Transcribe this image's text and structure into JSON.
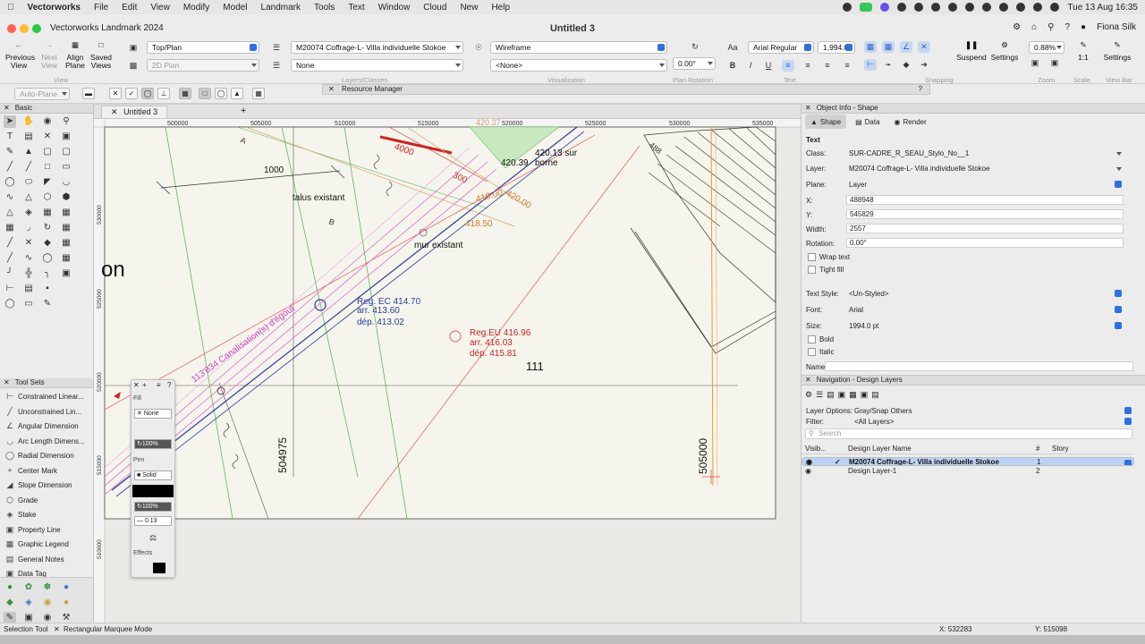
{
  "menubar": {
    "app": "Vectorworks",
    "items": [
      "File",
      "Edit",
      "View",
      "Modify",
      "Model",
      "Landmark",
      "Tools",
      "Text",
      "Window",
      "Cloud",
      "New",
      "Help"
    ],
    "clock": "Tue 13 Aug  16:35"
  },
  "window": {
    "title": "Vectorworks Landmark 2024",
    "doc_title": "Untitled 3",
    "user": "Fiona Silk"
  },
  "toolbar": {
    "previous_view": "Previous View",
    "next_view": "Next View",
    "align_plane": "Align Plane",
    "saved_views": "Saved Views",
    "view_group": "View",
    "view_select": "Top/Plan",
    "plane_select": "2D Plan",
    "layer_select": "M20074 Coffrage-L- Villa individuelle Stokoe",
    "class_select": "None",
    "layers_group": "Layers/Classes",
    "render_select": "Wireframe",
    "none_select": "<None>",
    "visualization_group": "Visualization",
    "rotation": "0.00°",
    "plan_rotation_group": "Plan Rotation",
    "font_select": "Arial Regular",
    "font_size": "1,994.0",
    "text_group": "Text",
    "snapping_group": "Snapping",
    "suspend": "Suspend",
    "settings": "Settings",
    "zoom_value": "0.88%",
    "zoom_group": "Zoom",
    "scale_value": "1:1",
    "scale_group": "Scale",
    "settings2": "Settings",
    "viewbar_group": "View Bar"
  },
  "modebar": {
    "auto_plane": "Auto-Plane"
  },
  "resource_manager": "Resource Manager",
  "basic": {
    "title": "Basic"
  },
  "toolsets": {
    "title": "Tool Sets",
    "items": [
      "Constrained Linear...",
      "Unconstrained Lin...",
      "Angular Dimension",
      "Arc Length Dimens...",
      "Radial Dimension",
      "Center Mark",
      "Slope Dimension",
      "Grade",
      "Stake",
      "Property Line",
      "Graphic Legend",
      "General Notes",
      "Data Tag"
    ]
  },
  "document": {
    "tab": "Untitled 3"
  },
  "ruler": {
    "top": [
      "500000",
      "505000",
      "510000",
      "515000",
      "520000",
      "525000",
      "530000",
      "535000"
    ],
    "left": [
      "530000",
      "525000",
      "520000",
      "515000",
      "510000"
    ]
  },
  "drawing": {
    "labels": {
      "dim1000": "1000",
      "talus": "talus existant",
      "mur": "mur existant",
      "d4000": "4000",
      "d300": "300",
      "sur_borne": "420.13 sur\nborne",
      "h42039": "420.39",
      "h41900": "419.00",
      "h42000": "420.00",
      "h41850": "418.50",
      "h42037": "420.37",
      "d488": "488",
      "reg_ec": "Reg. EC 414.70",
      "reg_ec_arr": "arr. 413.60",
      "reg_ec_dep": "dép. 413.02",
      "reg_eu": "Reg.EU 416.96",
      "reg_eu_arr": "arr. 416.03",
      "reg_eu_dep": "dép. 415.81",
      "n111": "111",
      "canal": "113'834 Canalisation(s) d'égout",
      "n504975": "504975",
      "n505000": "505000",
      "on": "on",
      "lblA": "A",
      "lblB": "B"
    }
  },
  "attributes": {
    "fill_label": "Fill",
    "fill_value": "None",
    "fill_opacity": "100%",
    "pen_label": "Pen",
    "pen_value": "Solid",
    "pen_opacity": "100%",
    "pen_weight": "0.13",
    "effects_label": "Effects"
  },
  "object_info": {
    "title": "Object Info - Shape",
    "tabs": [
      "Shape",
      "Data",
      "Render"
    ],
    "type": "Text",
    "class_label": "Class:",
    "class_value": "SUR-CADRE_R_SEAU_Stylo_No__1",
    "layer_label": "Layer:",
    "layer_value": "M20074 Coffrage-L- Villa individuelle Stokoe",
    "plane_label": "Plane:",
    "plane_value": "Layer",
    "x_label": "X:",
    "x_value": "488948",
    "y_label": "Y:",
    "y_value": "545829",
    "width_label": "Width:",
    "width_value": "2557",
    "rotation_label": "Rotation:",
    "rotation_value": "0.00°",
    "wrap_text": "Wrap text",
    "tight_fill": "Tight fill",
    "text_style_label": "Text Style:",
    "text_style_value": "<Un-Styled>",
    "font_label": "Font:",
    "font_value": "Arial",
    "size_label": "Size:",
    "size_value": "1994.0 pt",
    "bold": "Bold",
    "italic": "Italic",
    "name_label": "Name:"
  },
  "navigation": {
    "title": "Navigation - Design Layers",
    "layer_options_label": "Layer Options:",
    "layer_options_value": "Gray/Snap Others",
    "filter_label": "Filter:",
    "filter_value": "<All Layers>",
    "search_placeholder": "Search",
    "col_visibility": "Visib...",
    "col_name": "Design Layer Name",
    "col_number": "#",
    "col_story": "Story",
    "rows": [
      {
        "name": "M20074 Coffrage-L- Villa individuelle Stokoe",
        "number": "1"
      },
      {
        "name": "Design Layer-1",
        "number": "2"
      }
    ]
  },
  "status": {
    "tool": "Selection Tool",
    "mode": "Rectangular Marquee Mode",
    "x": "X: 532283",
    "y": "Y: 515098"
  }
}
